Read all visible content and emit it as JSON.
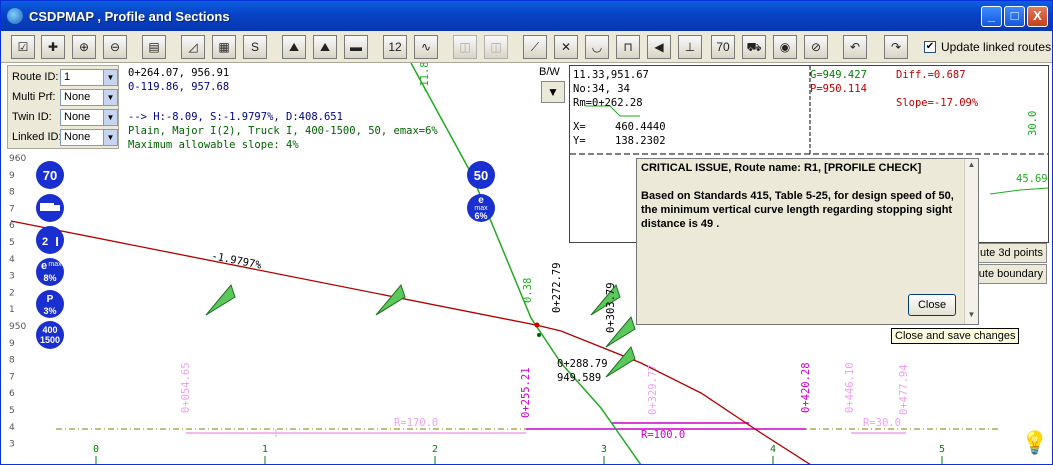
{
  "window": {
    "title": "CSDPMAP , Profile and Sections",
    "min": "_",
    "max": "□",
    "close": "X"
  },
  "toolbar": {
    "buttons": [
      {
        "icon": "checklist-icon",
        "glyph": "☑"
      },
      {
        "icon": "pan-icon",
        "glyph": "✚"
      },
      {
        "icon": "zoom-in-icon",
        "glyph": "⊕"
      },
      {
        "icon": "zoom-out-icon",
        "glyph": "⊖"
      },
      {
        "icon": "profile-icon",
        "glyph": "▤"
      },
      {
        "icon": "edit-profile-icon",
        "glyph": "◿"
      },
      {
        "icon": "grid-icon",
        "glyph": "▦"
      },
      {
        "icon": "s-icon",
        "glyph": "S"
      },
      {
        "icon": "road-icon-1",
        "glyph": "⛰"
      },
      {
        "icon": "road-icon-2",
        "glyph": "⛰"
      },
      {
        "icon": "road-icon-3",
        "glyph": "▬"
      },
      {
        "icon": "twelve-icon",
        "glyph": "12"
      },
      {
        "icon": "chart-icon",
        "glyph": "∿"
      },
      {
        "icon": "disabled-icon-1",
        "glyph": "◫"
      },
      {
        "icon": "disabled-icon-2",
        "glyph": "◫"
      },
      {
        "icon": "slope-icon",
        "glyph": "⟋"
      },
      {
        "icon": "x-mark-icon",
        "glyph": "✕"
      },
      {
        "icon": "sag-icon",
        "glyph": "◡"
      },
      {
        "icon": "crest-icon",
        "glyph": "⊓"
      },
      {
        "icon": "trumpet-icon",
        "glyph": "◀"
      },
      {
        "icon": "profile-edit-icon",
        "glyph": "⊥"
      },
      {
        "icon": "speed-70-icon",
        "glyph": "70"
      },
      {
        "icon": "truck-icon",
        "glyph": "⛟"
      },
      {
        "icon": "eye-icon",
        "glyph": "◉"
      },
      {
        "icon": "no-pass-icon",
        "glyph": "⊘"
      },
      {
        "icon": "undo-icon",
        "glyph": "↶"
      },
      {
        "icon": "redo-icon",
        "glyph": "↷"
      }
    ],
    "update_label": "Update linked routes",
    "update_checked": "✔"
  },
  "left_panel": {
    "route_id_label": "Route ID:",
    "route_id_value": "1",
    "multi_prf_label": "Multi Prf:",
    "multi_prf_value": "None",
    "twin_id_label": "Twin ID:",
    "twin_id_value": "None",
    "linked_id_label": "Linked ID:",
    "linked_id_value": "None"
  },
  "header_text": {
    "line1": "0+264.07, 956.91",
    "line2": "0-119.86, 957.68",
    "line3": "--> H:-8.09, S:-1.9797%, D:408.651",
    "line4": "Plain, Major I(2), Truck I, 400-1500, 50, emax=6%",
    "line5": "Maximum allowable slope: 4%"
  },
  "bw": {
    "label": "B/W",
    "button": "▼"
  },
  "info_box": {
    "a1": "11.33,951.67",
    "a2": "No:34, 34",
    "a3": "Rm=0+262.28",
    "x_label": "X=",
    "x_value": "460.4440",
    "y_label": "Y=",
    "y_value": "138.2302",
    "g": "G=949.427",
    "diff": "Diff.=0.687",
    "p": "P=950.114",
    "slope": "Slope=-17.09%",
    "v30": "30.0",
    "v45": "45.69"
  },
  "dialog": {
    "title": "CRITICAL ISSUE, Route name: R1, [PROFILE CHECK]",
    "body": "Based on Standards 415, Table 5-25, for design speed of 50, the minimum vertical curve length regarding stopping sight distance is 49 .",
    "close_label": "Close"
  },
  "side_buttons": {
    "b1": "ute 3d points",
    "b2": "ute boundary"
  },
  "tooltip": "Close and save changes",
  "y_axis": {
    "labels": [
      "960",
      "9",
      "8",
      "7",
      "6",
      "5",
      "4",
      "3",
      "2",
      "1",
      "950",
      "9",
      "8",
      "7",
      "6",
      "5",
      "4",
      "3"
    ]
  },
  "x_axis": {
    "labels": [
      "0",
      "1",
      "2",
      "3",
      "4",
      "5"
    ]
  },
  "signs": {
    "speed_left": "70",
    "emax": "8%",
    "p": "3%",
    "range_top": "400",
    "range_bottom": "1500",
    "speed_right": "50",
    "emax_right": "6%",
    "e_letter": "e",
    "max_word": "max",
    "p_letter": "P",
    "i_letter": "I",
    "two": "2"
  },
  "profile_labels": {
    "slope": "-1.9797%",
    "sta_272": "0+272.79",
    "sta_303": "0+303.79",
    "v038": "0.38",
    "v118": "-11.8",
    "pvi_sta": "0+288.79",
    "pvi_elev": "949.589",
    "sta_054": "0+054.65",
    "sta_255": "0+255.21",
    "sta_329": "0+329.77",
    "sta_420": "0+420.28",
    "sta_446": "0+446.10",
    "sta_477": "0+477.94",
    "r170": "R=170.0",
    "r100": "R=100.0",
    "r30": "R=30.0"
  },
  "colors": {
    "profile": "#b00000",
    "ground": "#22aa22",
    "station": "#cc00cc",
    "station_light": "#f0a0f0",
    "axis_green": "#008000",
    "sign_blue": "#1a2fd0"
  }
}
